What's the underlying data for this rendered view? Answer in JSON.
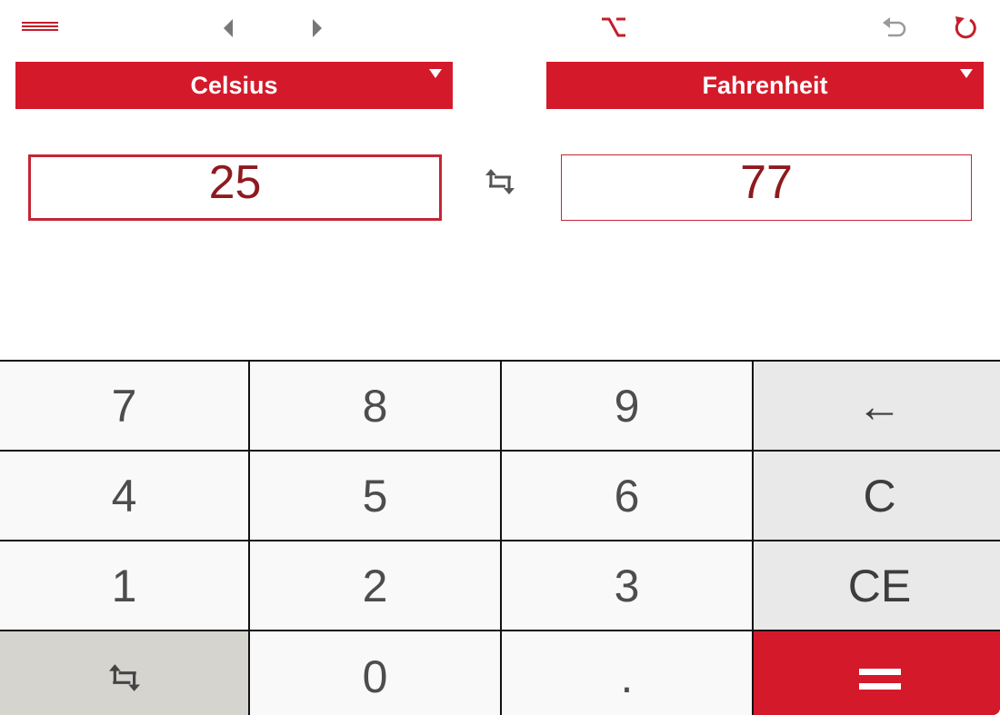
{
  "theme": {
    "accent": "#d41a2a",
    "value_text": "#8e1a1f",
    "icon_dark": "#555555",
    "icon_red": "#c41e2a"
  },
  "toolbar": {
    "icons": [
      "menu-icon",
      "back-arrow-icon",
      "forward-arrow-icon",
      "option-key-icon",
      "undo-icon",
      "refresh-icon"
    ]
  },
  "converter": {
    "from_unit": "Celsius",
    "to_unit": "Fahrenheit",
    "from_value": "25",
    "to_value": "77",
    "swap_icon": "swap-arrows-icon"
  },
  "keypad": {
    "rows": [
      [
        "7",
        "8",
        "9",
        "←"
      ],
      [
        "4",
        "5",
        "6",
        "C"
      ],
      [
        "1",
        "2",
        "3",
        "CE"
      ],
      [
        "swap-arrows-icon",
        "0",
        ".",
        "equals-icon"
      ]
    ],
    "key_7": "7",
    "key_8": "8",
    "key_9": "9",
    "key_backspace": "←",
    "key_4": "4",
    "key_5": "5",
    "key_6": "6",
    "key_clear": "C",
    "key_1": "1",
    "key_2": "2",
    "key_3": "3",
    "key_clear_entry": "CE",
    "key_0": "0",
    "key_decimal": "."
  }
}
